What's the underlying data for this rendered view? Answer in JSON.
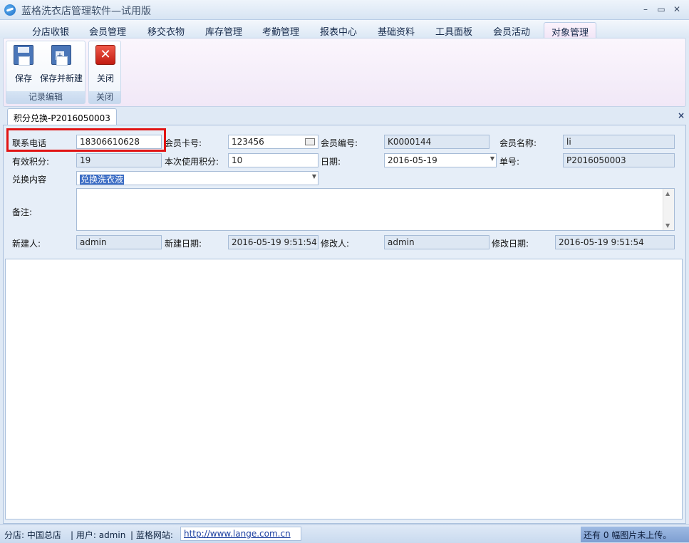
{
  "window": {
    "title": "蓝格洗衣店管理软件—试用版",
    "minimize": "–",
    "maximize": "▭",
    "close": "✕"
  },
  "menu_tabs": [
    "分店收银",
    "会员管理",
    "移交衣物",
    "库存管理",
    "考勤管理",
    "报表中心",
    "基础资料",
    "工具面板",
    "会员活动",
    "对象管理"
  ],
  "ribbon": {
    "save_label": "保存",
    "save_new_label": "保存并新建",
    "record_group": "记录编辑",
    "close_label": "关闭",
    "close_group": "关闭"
  },
  "doc_tab": {
    "title": "积分兑换-P2016050003",
    "close": "×"
  },
  "form": {
    "phone_label": "联系电话",
    "phone_value": "18306610628",
    "card_label": "会员卡号:",
    "card_value": "123456",
    "member_no_label": "会员编号:",
    "member_no_value": "K0000144",
    "member_name_label": "会员名称:",
    "member_name_value": "li",
    "points_label": "有效积分:",
    "points_value": "19",
    "use_points_label": "本次使用积分:",
    "use_points_value": "10",
    "date_label": "日期:",
    "date_value": "2016-05-19",
    "order_no_label": "单号:",
    "order_no_value": "P2016050003",
    "exchange_label": "兑换内容",
    "exchange_value": "兑换洗衣液",
    "notes_label": "备注:",
    "creator_label": "新建人:",
    "creator_value": "admin",
    "created_label": "新建日期:",
    "created_value": "2016-05-19 9:51:54",
    "modifier_label": "修改人:",
    "modifier_value": "admin",
    "modified_label": "修改日期:",
    "modified_value": "2016-05-19 9:51:54"
  },
  "status": {
    "branch": "分店: 中国总店",
    "user": "| 用户: admin",
    "site_label": "| 蓝格网站:",
    "site_url": "http://www.lange.com.cn",
    "pending": "还有 0 幅图片未上传。"
  },
  "colors": {
    "highlight": "#e11414",
    "accent": "#3b6cc4"
  }
}
